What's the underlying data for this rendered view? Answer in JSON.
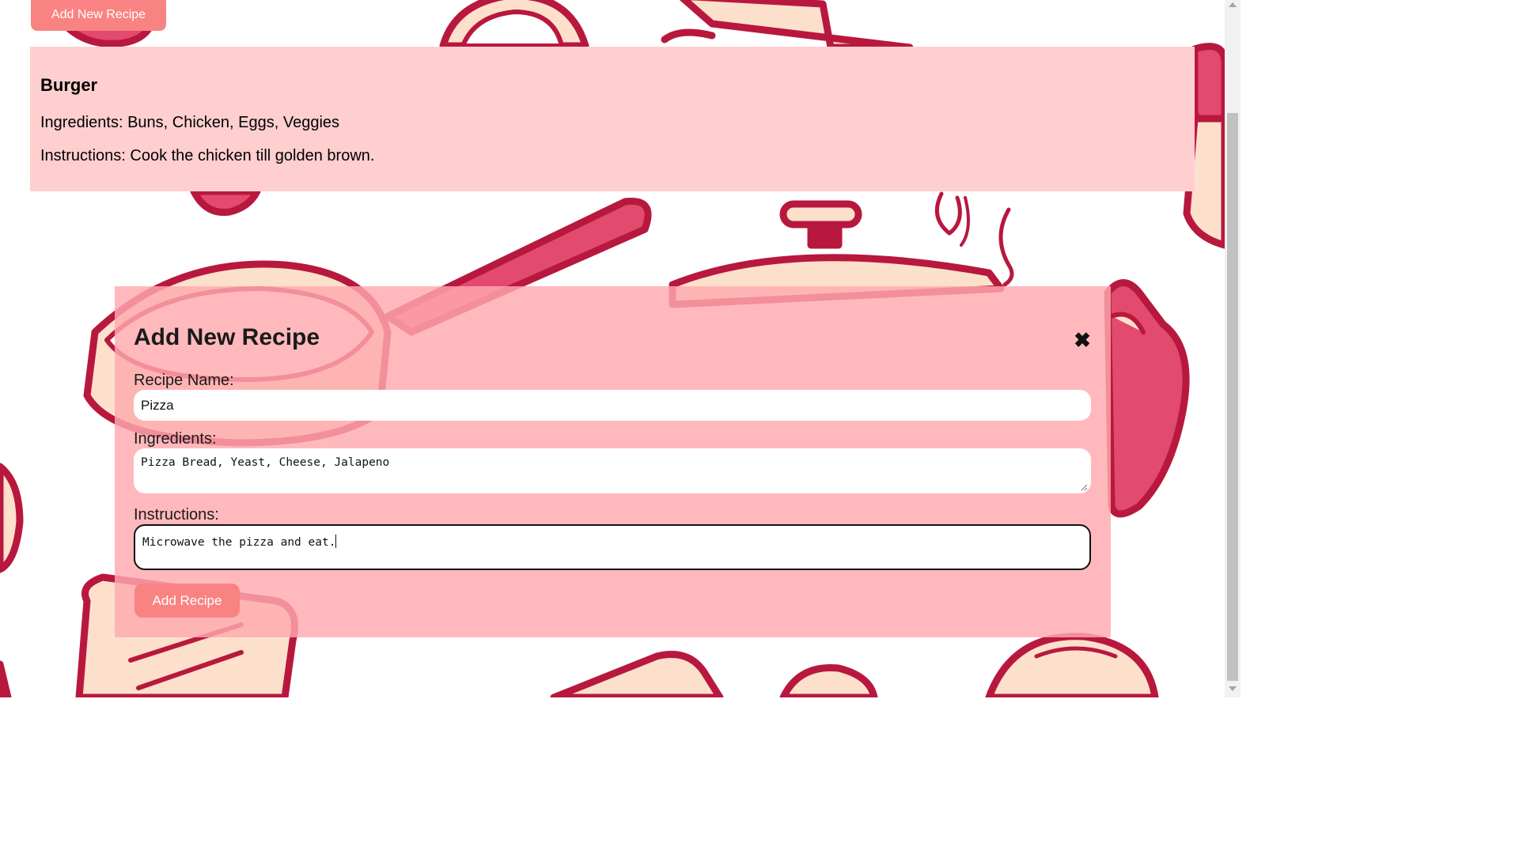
{
  "header": {
    "add_button_label": "Add New Recipe"
  },
  "recipes": [
    {
      "name": "Burger",
      "ingredients": "Ingredients: Buns, Chicken, Eggs, Veggies",
      "instructions": "Instructions: Cook the chicken till golden brown."
    }
  ],
  "modal": {
    "title": "Add New Recipe",
    "close_icon": "close-icon",
    "name_label": "Recipe Name:",
    "name_value": "Pizza",
    "ingredients_label": "Ingredients:",
    "ingredients_value": "Pizza Bread, Yeast, Cheese, Jalapeno",
    "instructions_label": "Instructions:",
    "instructions_value": "Microwave the pizza and eat.",
    "submit_label": "Add Recipe"
  },
  "colors": {
    "button": "#f98382",
    "card": "#ffcfcf",
    "modal": "#ffaaae",
    "art_stroke": "#b8183e",
    "art_fill": "#fde0cc",
    "art_accent": "#e24a6e"
  }
}
